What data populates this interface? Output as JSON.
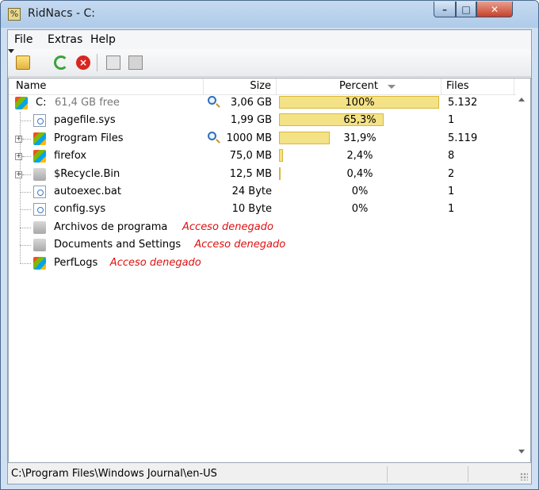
{
  "window": {
    "title": "RidNacs - C:"
  },
  "menu": [
    "File",
    "Extras",
    "Help"
  ],
  "columns": {
    "name": "Name",
    "size": "Size",
    "percent": "Percent",
    "files": "Files"
  },
  "rows": [
    {
      "name": "C:",
      "free": "61,4 GB free",
      "size": "3,06 GB",
      "percent": "100%",
      "fraction": 1.0,
      "files": "5.132",
      "icon": "drive-icon",
      "magnifier": true
    },
    {
      "name": "pagefile.sys",
      "size": "1,99 GB",
      "percent": "65,3%",
      "fraction": 0.653,
      "files": "1",
      "icon": "file-icon"
    },
    {
      "name": "Program Files",
      "size": "1000 MB",
      "percent": "31,9%",
      "fraction": 0.319,
      "files": "5.119",
      "icon": "folder-icon",
      "magnifier": true,
      "expandable": true
    },
    {
      "name": "firefox",
      "size": "75,0 MB",
      "percent": "2,4%",
      "fraction": 0.024,
      "files": "8",
      "icon": "folder-icon",
      "expandable": true
    },
    {
      "name": "$Recycle.Bin",
      "size": "12,5 MB",
      "percent": "0,4%",
      "fraction": 0.004,
      "files": "2",
      "icon": "folder-gray-icon",
      "expandable": true
    },
    {
      "name": "autoexec.bat",
      "size": "24 Byte",
      "percent": "0%",
      "fraction": 0,
      "files": "1",
      "icon": "file-icon"
    },
    {
      "name": "config.sys",
      "size": "10 Byte",
      "percent": "0%",
      "fraction": 0,
      "files": "1",
      "icon": "file-icon"
    },
    {
      "name": "Archivos de programa",
      "error": "Acceso denegado",
      "icon": "folder-gray-icon"
    },
    {
      "name": "Documents and Settings",
      "error": "Acceso denegado",
      "icon": "folder-gray-icon"
    },
    {
      "name": "PerfLogs",
      "error": "Acceso denegado",
      "icon": "folder-icon"
    }
  ],
  "status": {
    "path": "C:\\Program Files\\Windows Journal\\en-US"
  }
}
